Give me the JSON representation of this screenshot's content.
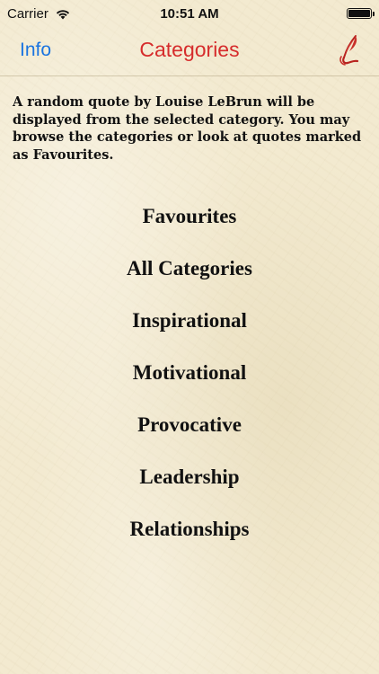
{
  "status_bar": {
    "carrier": "Carrier",
    "time": "10:51 AM",
    "wifi_icon": "wifi-icon",
    "battery_icon": "battery-icon"
  },
  "nav": {
    "info_label": "Info",
    "title": "Categories",
    "feather_icon": "quill-pen-icon"
  },
  "description": "A random quote by Louise LeBrun will be displayed from the selected category. You may browse the categories or look at quotes marked as Favourites.",
  "categories": [
    "Favourites",
    "All Categories",
    "Inspirational",
    "Motivational",
    "Provocative",
    "Leadership",
    "Relationships"
  ],
  "colors": {
    "background": "#f3ead0",
    "nav_link": "#1a74e0",
    "nav_title": "#d62c2c",
    "text": "#111111"
  }
}
